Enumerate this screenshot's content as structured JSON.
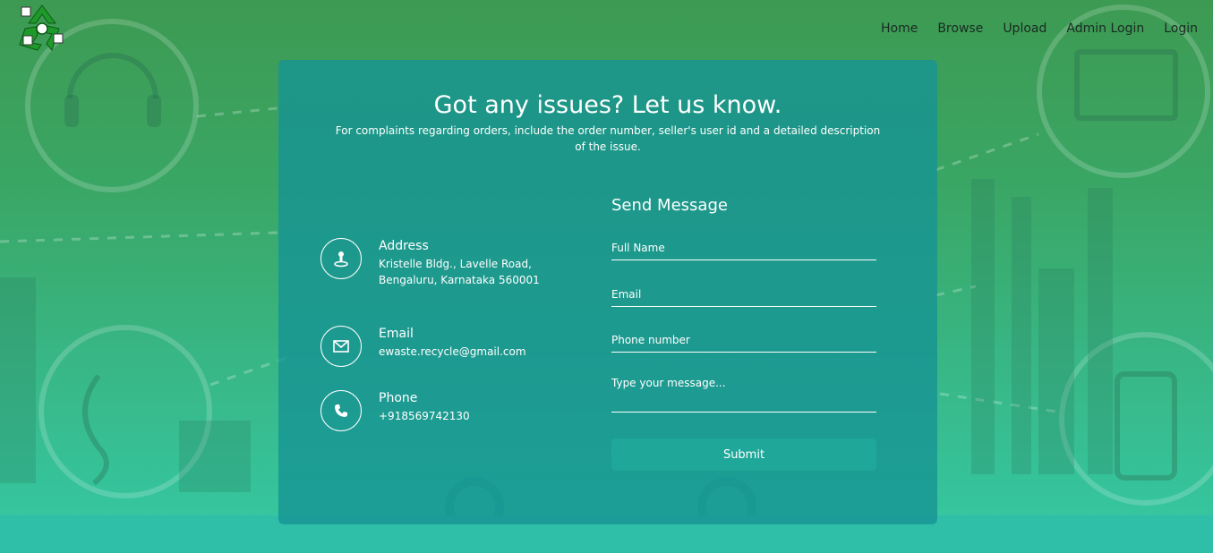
{
  "nav": {
    "items": [
      {
        "label": "Home"
      },
      {
        "label": "Browse"
      },
      {
        "label": "Upload"
      },
      {
        "label": "Admin Login"
      },
      {
        "label": "Login"
      }
    ]
  },
  "logo": {
    "icon": "recycle-icon"
  },
  "contact": {
    "title": "Got any issues? Let us know.",
    "subtitle": "For complaints regarding orders, include the order number, seller's user id and a detailed description of the issue.",
    "address": {
      "label": "Address",
      "value": "Kristelle Bldg., Lavelle Road, Bengaluru, Karnataka 560001",
      "icon": "map-pin-icon"
    },
    "email": {
      "label": "Email",
      "value": "ewaste.recycle@gmail.com",
      "icon": "envelope-icon"
    },
    "phone": {
      "label": "Phone",
      "value": "+918569742130",
      "icon": "phone-icon"
    }
  },
  "form": {
    "heading": "Send Message",
    "full_name_placeholder": "Full Name",
    "email_placeholder": "Email",
    "phone_placeholder": "Phone number",
    "message_placeholder": "Type your message...",
    "submit_label": "Submit"
  },
  "colors": {
    "card": "#179494",
    "accent": "#1fa89a",
    "background_top": "#3d9a52",
    "background_bottom": "#35c9a4"
  }
}
